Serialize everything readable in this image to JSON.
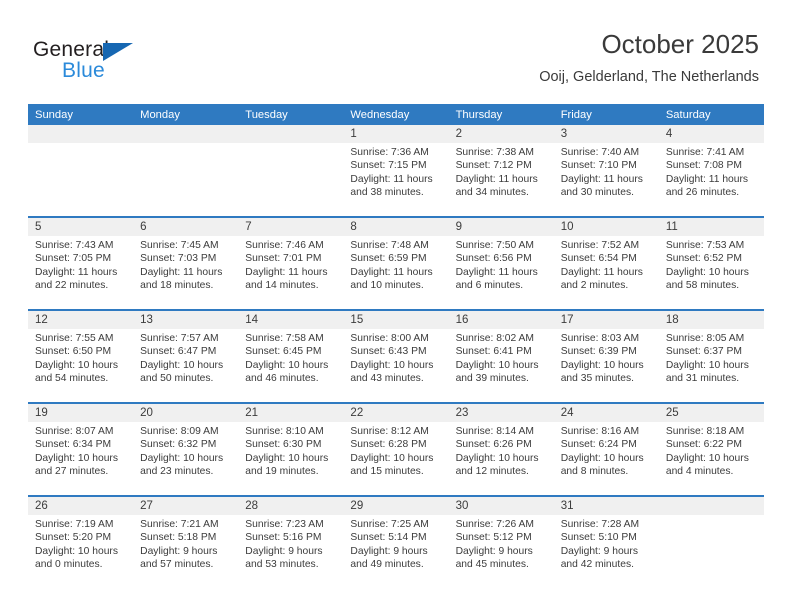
{
  "brand": {
    "name_top": "General",
    "name_bottom": "Blue",
    "triangle_color": "#1667b2",
    "blue_text_color": "#2b8ada"
  },
  "header": {
    "title": "October 2025",
    "subtitle": "Ooij, Gelderland, The Netherlands"
  },
  "theme": {
    "header_row_color": "#2f7ac1",
    "date_band_color": "#f0f0f0",
    "text_color": "#3c3c3c"
  },
  "calendar": {
    "weekdays": [
      "Sunday",
      "Monday",
      "Tuesday",
      "Wednesday",
      "Thursday",
      "Friday",
      "Saturday"
    ],
    "weeks": [
      [
        {
          "date": "",
          "lines": []
        },
        {
          "date": "",
          "lines": []
        },
        {
          "date": "",
          "lines": []
        },
        {
          "date": "1",
          "lines": [
            "Sunrise: 7:36 AM",
            "Sunset: 7:15 PM",
            "Daylight: 11 hours",
            "and 38 minutes."
          ]
        },
        {
          "date": "2",
          "lines": [
            "Sunrise: 7:38 AM",
            "Sunset: 7:12 PM",
            "Daylight: 11 hours",
            "and 34 minutes."
          ]
        },
        {
          "date": "3",
          "lines": [
            "Sunrise: 7:40 AM",
            "Sunset: 7:10 PM",
            "Daylight: 11 hours",
            "and 30 minutes."
          ]
        },
        {
          "date": "4",
          "lines": [
            "Sunrise: 7:41 AM",
            "Sunset: 7:08 PM",
            "Daylight: 11 hours",
            "and 26 minutes."
          ]
        }
      ],
      [
        {
          "date": "5",
          "lines": [
            "Sunrise: 7:43 AM",
            "Sunset: 7:05 PM",
            "Daylight: 11 hours",
            "and 22 minutes."
          ]
        },
        {
          "date": "6",
          "lines": [
            "Sunrise: 7:45 AM",
            "Sunset: 7:03 PM",
            "Daylight: 11 hours",
            "and 18 minutes."
          ]
        },
        {
          "date": "7",
          "lines": [
            "Sunrise: 7:46 AM",
            "Sunset: 7:01 PM",
            "Daylight: 11 hours",
            "and 14 minutes."
          ]
        },
        {
          "date": "8",
          "lines": [
            "Sunrise: 7:48 AM",
            "Sunset: 6:59 PM",
            "Daylight: 11 hours",
            "and 10 minutes."
          ]
        },
        {
          "date": "9",
          "lines": [
            "Sunrise: 7:50 AM",
            "Sunset: 6:56 PM",
            "Daylight: 11 hours",
            "and 6 minutes."
          ]
        },
        {
          "date": "10",
          "lines": [
            "Sunrise: 7:52 AM",
            "Sunset: 6:54 PM",
            "Daylight: 11 hours",
            "and 2 minutes."
          ]
        },
        {
          "date": "11",
          "lines": [
            "Sunrise: 7:53 AM",
            "Sunset: 6:52 PM",
            "Daylight: 10 hours",
            "and 58 minutes."
          ]
        }
      ],
      [
        {
          "date": "12",
          "lines": [
            "Sunrise: 7:55 AM",
            "Sunset: 6:50 PM",
            "Daylight: 10 hours",
            "and 54 minutes."
          ]
        },
        {
          "date": "13",
          "lines": [
            "Sunrise: 7:57 AM",
            "Sunset: 6:47 PM",
            "Daylight: 10 hours",
            "and 50 minutes."
          ]
        },
        {
          "date": "14",
          "lines": [
            "Sunrise: 7:58 AM",
            "Sunset: 6:45 PM",
            "Daylight: 10 hours",
            "and 46 minutes."
          ]
        },
        {
          "date": "15",
          "lines": [
            "Sunrise: 8:00 AM",
            "Sunset: 6:43 PM",
            "Daylight: 10 hours",
            "and 43 minutes."
          ]
        },
        {
          "date": "16",
          "lines": [
            "Sunrise: 8:02 AM",
            "Sunset: 6:41 PM",
            "Daylight: 10 hours",
            "and 39 minutes."
          ]
        },
        {
          "date": "17",
          "lines": [
            "Sunrise: 8:03 AM",
            "Sunset: 6:39 PM",
            "Daylight: 10 hours",
            "and 35 minutes."
          ]
        },
        {
          "date": "18",
          "lines": [
            "Sunrise: 8:05 AM",
            "Sunset: 6:37 PM",
            "Daylight: 10 hours",
            "and 31 minutes."
          ]
        }
      ],
      [
        {
          "date": "19",
          "lines": [
            "Sunrise: 8:07 AM",
            "Sunset: 6:34 PM",
            "Daylight: 10 hours",
            "and 27 minutes."
          ]
        },
        {
          "date": "20",
          "lines": [
            "Sunrise: 8:09 AM",
            "Sunset: 6:32 PM",
            "Daylight: 10 hours",
            "and 23 minutes."
          ]
        },
        {
          "date": "21",
          "lines": [
            "Sunrise: 8:10 AM",
            "Sunset: 6:30 PM",
            "Daylight: 10 hours",
            "and 19 minutes."
          ]
        },
        {
          "date": "22",
          "lines": [
            "Sunrise: 8:12 AM",
            "Sunset: 6:28 PM",
            "Daylight: 10 hours",
            "and 15 minutes."
          ]
        },
        {
          "date": "23",
          "lines": [
            "Sunrise: 8:14 AM",
            "Sunset: 6:26 PM",
            "Daylight: 10 hours",
            "and 12 minutes."
          ]
        },
        {
          "date": "24",
          "lines": [
            "Sunrise: 8:16 AM",
            "Sunset: 6:24 PM",
            "Daylight: 10 hours",
            "and 8 minutes."
          ]
        },
        {
          "date": "25",
          "lines": [
            "Sunrise: 8:18 AM",
            "Sunset: 6:22 PM",
            "Daylight: 10 hours",
            "and 4 minutes."
          ]
        }
      ],
      [
        {
          "date": "26",
          "lines": [
            "Sunrise: 7:19 AM",
            "Sunset: 5:20 PM",
            "Daylight: 10 hours",
            "and 0 minutes."
          ]
        },
        {
          "date": "27",
          "lines": [
            "Sunrise: 7:21 AM",
            "Sunset: 5:18 PM",
            "Daylight: 9 hours",
            "and 57 minutes."
          ]
        },
        {
          "date": "28",
          "lines": [
            "Sunrise: 7:23 AM",
            "Sunset: 5:16 PM",
            "Daylight: 9 hours",
            "and 53 minutes."
          ]
        },
        {
          "date": "29",
          "lines": [
            "Sunrise: 7:25 AM",
            "Sunset: 5:14 PM",
            "Daylight: 9 hours",
            "and 49 minutes."
          ]
        },
        {
          "date": "30",
          "lines": [
            "Sunrise: 7:26 AM",
            "Sunset: 5:12 PM",
            "Daylight: 9 hours",
            "and 45 minutes."
          ]
        },
        {
          "date": "31",
          "lines": [
            "Sunrise: 7:28 AM",
            "Sunset: 5:10 PM",
            "Daylight: 9 hours",
            "and 42 minutes."
          ]
        },
        {
          "date": "",
          "lines": []
        }
      ]
    ]
  }
}
